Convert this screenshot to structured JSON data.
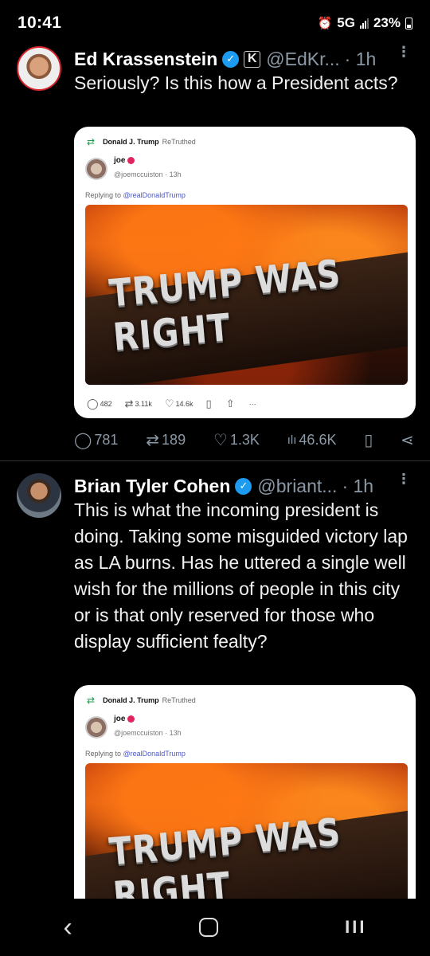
{
  "status": {
    "time": "10:41",
    "network": "5G",
    "battery": "23%"
  },
  "tweets": [
    {
      "name": "Ed Krassenstein",
      "handle": "@EdKr...",
      "time": "· 1h",
      "affiliate_badge": "K",
      "text": "Seriously?  Is this how a President acts?",
      "card": {
        "retruth_by": "Donald J. Trump",
        "retruth_label": "ReTruthed",
        "user": "joe",
        "handle_time": "@joemccuiston · 13h",
        "reply_prefix": "Replying to ",
        "reply_to": "@realDonaldTrump",
        "image_text": "TRUMP WAS RIGHT",
        "stats": {
          "replies": "482",
          "retruths": "3.11k",
          "likes": "14.6k",
          "more": "···"
        }
      },
      "stats": {
        "replies": "781",
        "retweets": "189",
        "likes": "1.3K",
        "views": "46.6K"
      }
    },
    {
      "name": "Brian Tyler Cohen",
      "handle": "@briant...",
      "time": "· 1h",
      "text": "This is what the incoming president is doing. Taking some misguided victory lap as LA burns. Has he uttered a single well wish for the millions of people in this city or is that only reserved for those who display sufficient fealty?",
      "card": {
        "retruth_by": "Donald J. Trump",
        "retruth_label": "ReTruthed",
        "user": "joe",
        "handle_time": "@joemccuiston · 13h",
        "reply_prefix": "Replying to ",
        "reply_to": "@realDonaldTrump",
        "image_text": "TRUMP WAS RIGHT"
      }
    }
  ],
  "icons": {
    "verified": "✓",
    "more": "⋮",
    "reply": "◯",
    "retweet": "⇄",
    "like": "♡",
    "views": "ılı",
    "bookmark": "▯",
    "share": "⋖",
    "back": "‹",
    "recent": "III"
  },
  "colors": {
    "accent": "#1d9bf0",
    "avatar_border": "#d5232b",
    "retruth_green": "#1a9b4a"
  }
}
